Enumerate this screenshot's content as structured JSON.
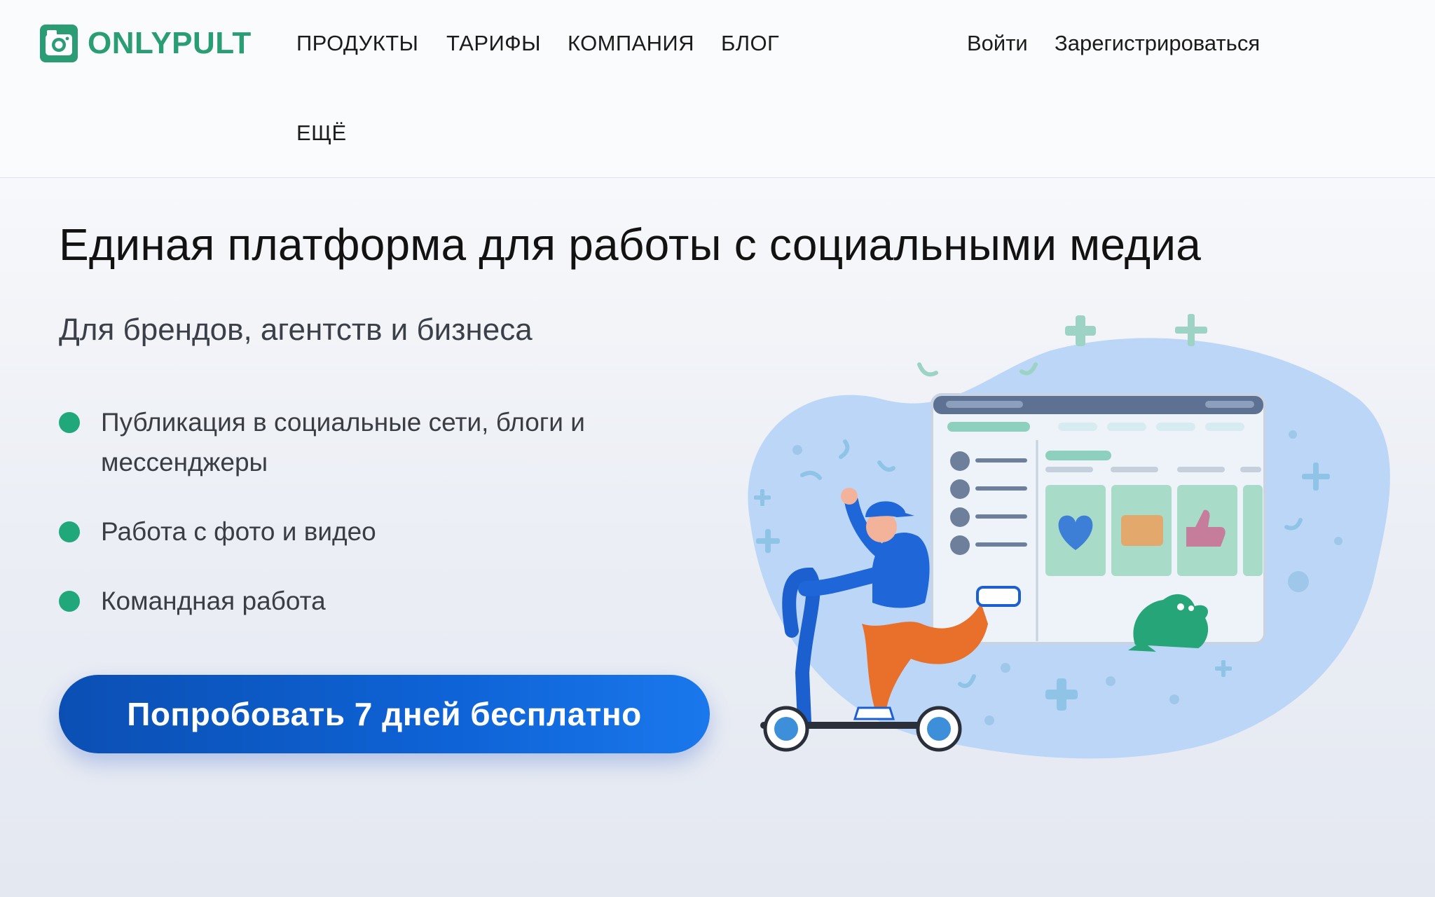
{
  "brand": {
    "name": "ONLYPULT",
    "color": "#2a9d74"
  },
  "nav": {
    "items": [
      "ПРОДУКТЫ",
      "ТАРИФЫ",
      "КОМПАНИЯ",
      "БЛОГ",
      "ЕЩЁ"
    ]
  },
  "auth": {
    "login": "Войти",
    "register": "Зарегистрироваться"
  },
  "hero": {
    "title": "Единая платформа для работы с социальными медиа",
    "subtitle": "Для брендов, агентств и бизнеса",
    "features": [
      "Публикация в социальные сети, блоги и мессенджеры",
      "Работа с фото и видео",
      "Командная работа"
    ],
    "cta": "Попробовать 7 дней бесплатно",
    "illustration": "scooter-rider-with-dashboard-illustration"
  },
  "colors": {
    "accent": "#21a87a",
    "cta": "#0e63d6",
    "text": "#121212"
  }
}
